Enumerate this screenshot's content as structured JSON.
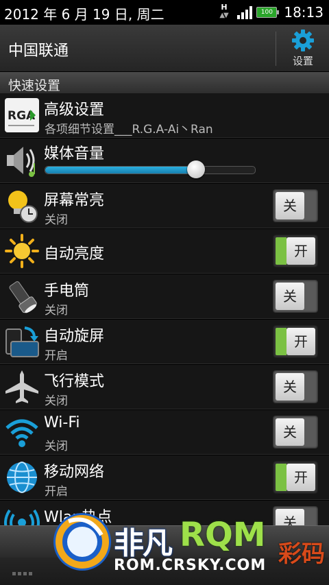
{
  "status_bar": {
    "date": "2012 年 6 月 19 日, 周二",
    "network_type": "H",
    "battery": "100",
    "time": "18:13"
  },
  "header": {
    "carrier": "中国联通",
    "settings_label": "设置"
  },
  "section": {
    "title": "快速设置"
  },
  "items": [
    {
      "title": "高级设置",
      "subtitle": "各项细节设置___R.G.A-Ai丶Ran",
      "icon": "rga-logo-icon",
      "icon_text": "RGA"
    },
    {
      "title": "媒体音量",
      "icon": "speaker-icon",
      "volume_level": 0.72
    },
    {
      "title": "屏幕常亮",
      "subtitle": "关闭",
      "icon": "bulb-clock-icon",
      "toggle": "关"
    },
    {
      "title": "自动亮度",
      "icon": "sun-icon",
      "toggle": "开"
    },
    {
      "title": "手电筒",
      "subtitle": "关闭",
      "icon": "flashlight-icon",
      "toggle": "关"
    },
    {
      "title": "自动旋屏",
      "subtitle": "开启",
      "icon": "rotate-screen-icon",
      "toggle": "开"
    },
    {
      "title": "飞行模式",
      "subtitle": "关闭",
      "icon": "airplane-icon",
      "toggle": "关"
    },
    {
      "title": "Wi-Fi",
      "subtitle": "关闭",
      "icon": "wifi-icon",
      "toggle": "关"
    },
    {
      "title": "移动网络",
      "subtitle": "开启",
      "icon": "globe-icon",
      "toggle": "开"
    },
    {
      "title": "Wlan热点",
      "icon": "hotspot-icon",
      "toggle": "关"
    }
  ],
  "watermark": {
    "brand_cn": "非凡",
    "brand_en": "RQM",
    "url": "ROM.CRSKY.COM",
    "tag": "彩码"
  },
  "colors": {
    "accent_blue": "#1a9fd8",
    "toggle_on_green": "#7bc143",
    "background": "#141414"
  }
}
